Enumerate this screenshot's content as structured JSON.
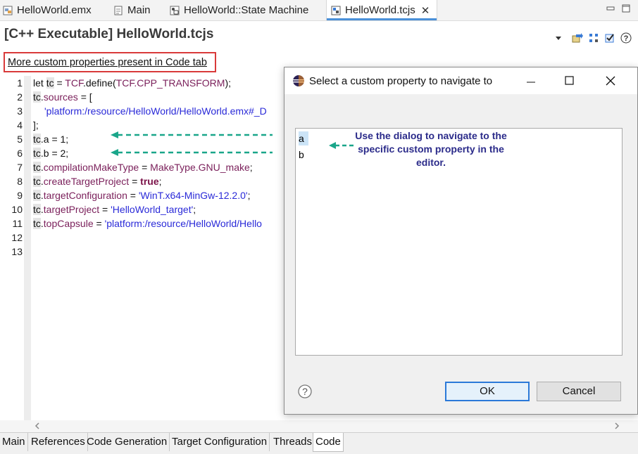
{
  "editor_tabs": [
    {
      "label": "HelloWorld.emx",
      "icon": "model-file-icon"
    },
    {
      "label": "Main",
      "icon": "document-icon"
    },
    {
      "label": "HelloWorld::State Machine",
      "icon": "state-machine-icon"
    },
    {
      "label": "HelloWorld.tcjs",
      "icon": "tcjs-file-icon",
      "active": true
    }
  ],
  "heading": "[C++ Executable] HelloWorld.tcjs",
  "more_link": "More custom properties present in Code tab",
  "line_numbers": [
    "1",
    "2",
    "3",
    "4",
    "5",
    "6",
    "7",
    "8",
    "9",
    "10",
    "11",
    "12",
    "13"
  ],
  "code": {
    "l1_a": "let ",
    "l1_tc": "tc",
    "l1_b": " = ",
    "l1_tcf": "TCF",
    "l1_c": ".define(",
    "l1_d": "TCF.CPP_TRANSFORM",
    "l1_e": ");",
    "l2_tc": "tc",
    "l2_a": ".",
    "l2_b": "sources",
    "l2_c": " = [",
    "l3_str": "'platform:/resource/HelloWorld/HelloWorld.emx#_D",
    "l4": "];",
    "l5_tc": "tc",
    "l5_a": ".a = 1;",
    "l6_tc": "tc",
    "l6_a": ".b = 2;",
    "l7_tc": "tc",
    "l7_a": ".",
    "l7_b": "compilationMakeType",
    "l7_c": " = ",
    "l7_d": "MakeType.GNU_make",
    "l7_e": ";",
    "l8_tc": "tc",
    "l8_a": ".",
    "l8_b": "createTargetProject",
    "l8_c": " = ",
    "l8_d": "true",
    "l8_e": ";",
    "l9_tc": "tc",
    "l9_a": ".",
    "l9_b": "targetConfiguration",
    "l9_c": " = ",
    "l9_d": "'WinT.x64-MinGw-12.2.0'",
    "l9_e": ";",
    "l10_tc": "tc",
    "l10_a": ".",
    "l10_b": "targetProject",
    "l10_c": " = ",
    "l10_d": "'HelloWorld_target'",
    "l10_e": ";",
    "l11_tc": "tc",
    "l11_a": ".",
    "l11_b": "topCapsule",
    "l11_c": " = ",
    "l11_d": "'platform:/resource/HelloWorld/Hello"
  },
  "bottom_tabs": [
    "Main",
    "References",
    "Code Generation",
    "Target Configuration",
    "Threads",
    "Code"
  ],
  "active_bottom_tab": "Code",
  "dialog": {
    "title": "Select a custom property to navigate to",
    "items": [
      "a",
      "b"
    ],
    "selected": "a",
    "annotation": "Use the dialog to navigate to the specific custom property in the editor.",
    "ok_label": "OK",
    "cancel_label": "Cancel",
    "help_icon": "?"
  },
  "colors": {
    "annotation_arrow": "#1aa68a",
    "annotation_text": "#2b2b8a",
    "highlight_box": "#d93a3a",
    "string": "#2a2ad8",
    "property": "#7a1f5a",
    "active_tab_accent": "#4a90d9"
  }
}
